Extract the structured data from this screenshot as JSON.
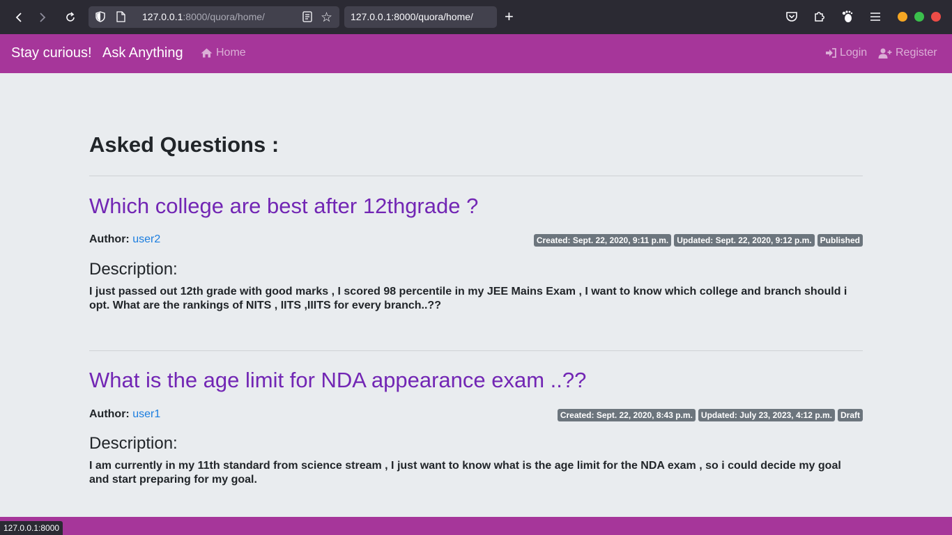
{
  "browser": {
    "url_host": "127.0.0.1",
    "url_rest": ":8000/quora/home/",
    "tab_title": "127.0.0.1:8000/quora/home/",
    "status_url": "127.0.0.1:8000",
    "window_dots": [
      "#f5a623",
      "#3bbf4c",
      "#ec4c47"
    ]
  },
  "navbar": {
    "brand": "Stay curious!",
    "brand2": "Ask Anything",
    "home": "Home",
    "login": "Login",
    "register": "Register",
    "bg_color": "#a6369a"
  },
  "main": {
    "heading": "Asked Questions :",
    "questions": [
      {
        "title": "Which college are best after 12thgrade ?",
        "author_label": "Author:",
        "author": "user2",
        "created": "Created: Sept. 22, 2020, 9:11 p.m.",
        "updated": "Updated: Sept. 22, 2020, 9:12 p.m.",
        "status": "Published",
        "description_label": "Description:",
        "description": "I just passed out 12th grade with good marks , I scored 98 percentile in my JEE Mains Exam , I want to know which college and branch should i opt. What are the rankings of NITS , IITS ,IIITS for every branch..??"
      },
      {
        "title": "What is the age limit for NDA appearance exam ..??",
        "author_label": "Author:",
        "author": "user1",
        "created": "Created: Sept. 22, 2020, 8:43 p.m.",
        "updated": "Updated: July 23, 2023, 4:12 p.m.",
        "status": "Draft",
        "description_label": "Description:",
        "description": "I am currently in my 11th standard from science stream , I just want to know what is the age limit for the NDA exam , so i could decide my goal and start preparing for my goal."
      }
    ]
  }
}
